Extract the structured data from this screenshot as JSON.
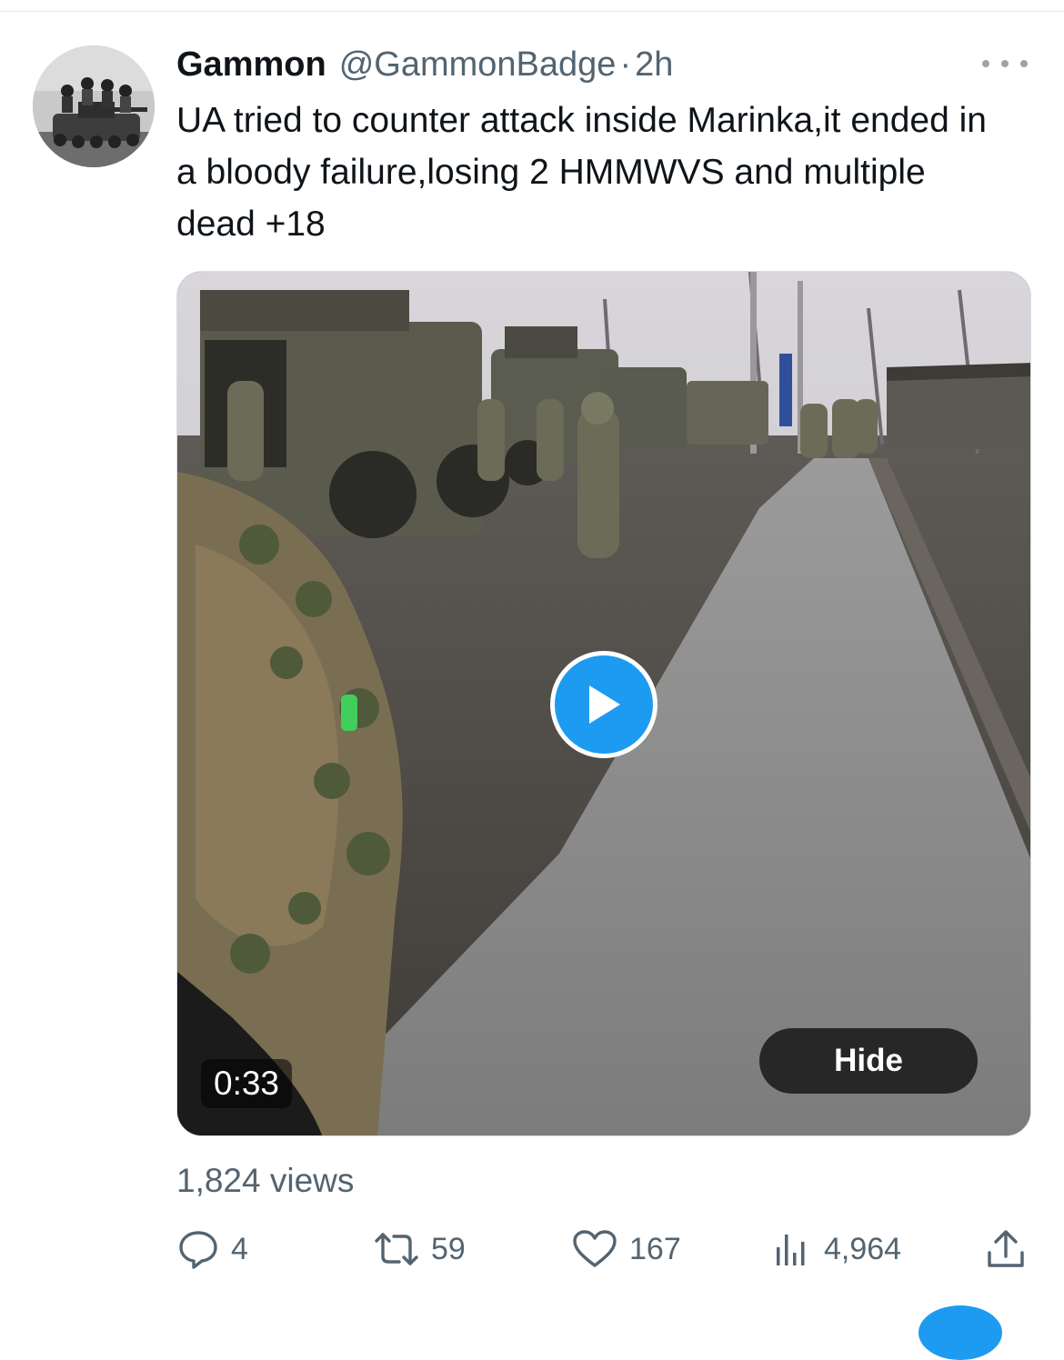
{
  "tweet": {
    "display_name": "Gammon",
    "handle": "@GammonBadge",
    "separator": "·",
    "time": "2h",
    "text": "UA tried to counter attack inside Marinka,it ended in a bloody failure,losing 2 HMMWVS and multiple dead +18"
  },
  "media": {
    "duration": "0:33",
    "hide_label": "Hide",
    "play_icon": "play-icon"
  },
  "stats": {
    "views": "1,824 views"
  },
  "actions": {
    "replies": "4",
    "retweets": "59",
    "likes": "167",
    "analytics": "4,964"
  },
  "colors": {
    "accent": "#1d9bf0",
    "secondary_text": "#536471",
    "primary_text": "#0f1419"
  }
}
